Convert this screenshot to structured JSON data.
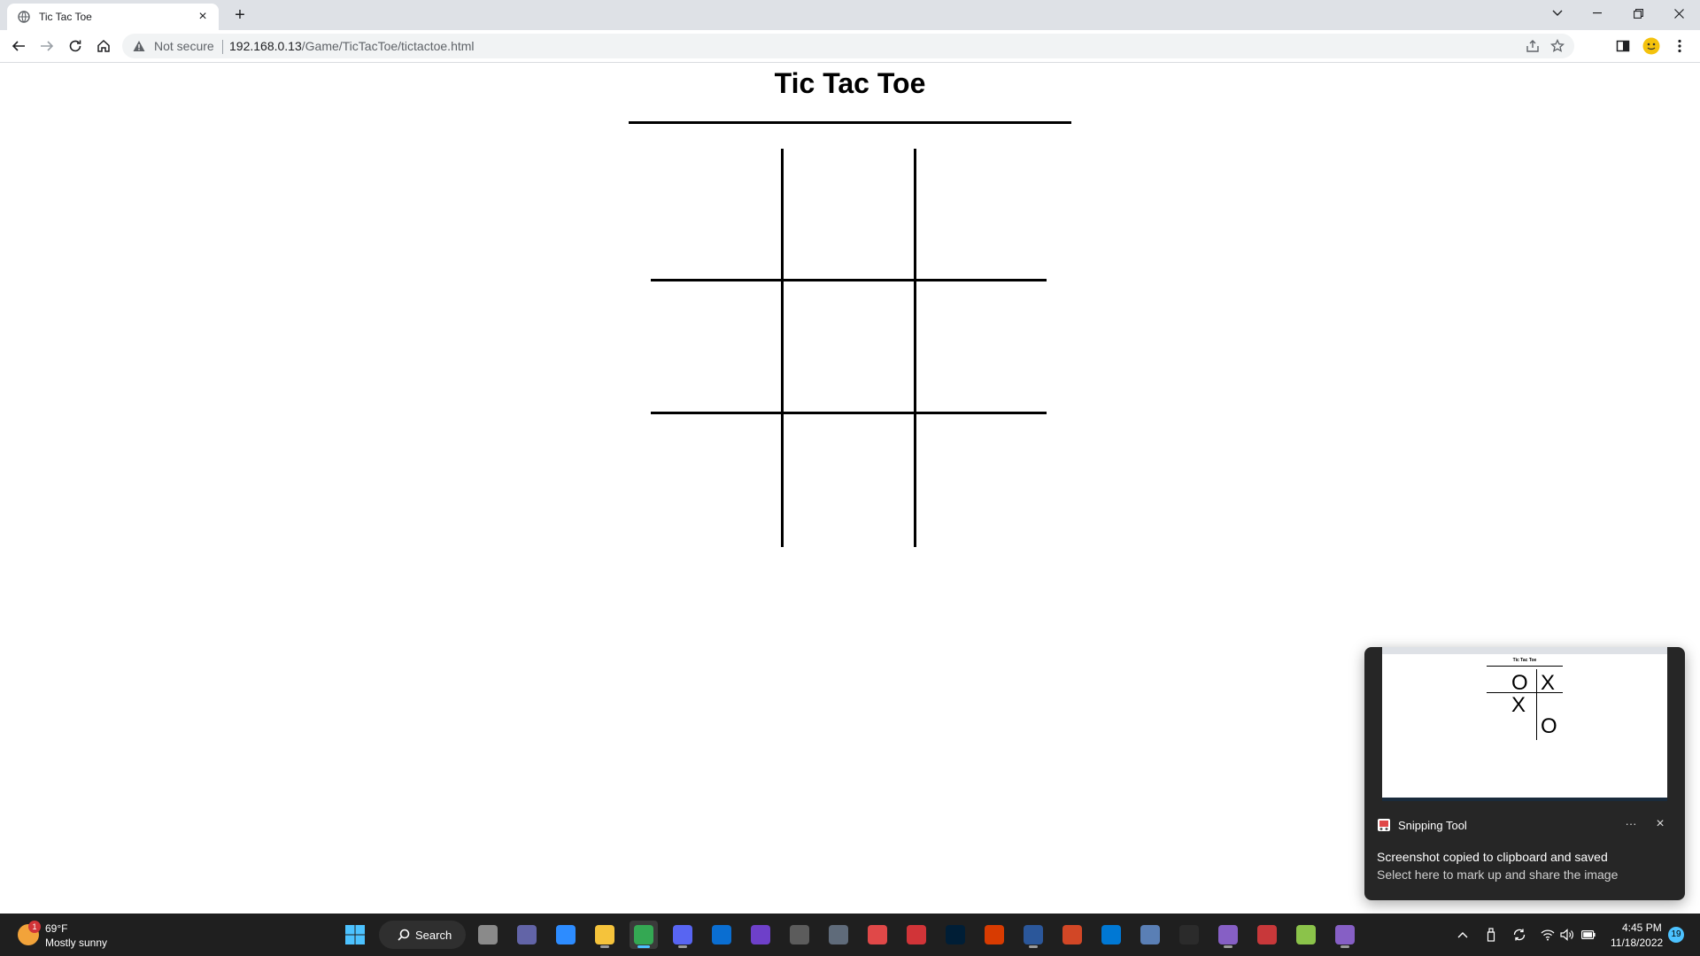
{
  "browser": {
    "tab_title": "Tic Tac Toe",
    "tab_close_glyph": "×",
    "newtab_glyph": "+",
    "security_label": "Not secure",
    "url_host": "192.168.0.13",
    "url_path": "/Game/TicTacToe/tictactoe.html"
  },
  "page": {
    "title": "Tic Tac Toe",
    "board": [
      "",
      "",
      "",
      "",
      "",
      "",
      "",
      "",
      ""
    ]
  },
  "toast": {
    "app_name": "Snipping Tool",
    "more_glyph": "···",
    "close_glyph": "×",
    "heading": "Screenshot copied to clipboard and saved",
    "body": "Select here to mark up and share the image",
    "thumbnail": {
      "title": "Tic Tac Toe",
      "marks": [
        "O",
        "X",
        "X",
        "",
        "",
        "O"
      ]
    }
  },
  "taskbar": {
    "weather_badge": "1",
    "weather_temp": "69°F",
    "weather_desc": "Mostly sunny",
    "search_label": "Search",
    "clock_time": "4:45 PM",
    "clock_date": "11/18/2022",
    "notification_count": "19",
    "apps": [
      {
        "icon": "task-view-icon",
        "color": "#8a8a8a"
      },
      {
        "icon": "teams-chat-icon",
        "color": "#6264a7"
      },
      {
        "icon": "zoom-icon",
        "color": "#2d8cff"
      },
      {
        "icon": "file-explorer-icon",
        "color": "#f5c33b"
      },
      {
        "icon": "chrome-icon",
        "color": "#34a853"
      },
      {
        "icon": "discord-icon",
        "color": "#5865f2"
      },
      {
        "icon": "mail-icon",
        "color": "#0a6ed1"
      },
      {
        "icon": "github-icon",
        "color": "#6e40c9"
      },
      {
        "icon": "visual-studio-installer-icon",
        "color": "#5c5c5c"
      },
      {
        "icon": "calculator-icon",
        "color": "#5f6b7a"
      },
      {
        "icon": "snipping-tool-icon",
        "color": "#e04848"
      },
      {
        "icon": "screen-recorder-icon",
        "color": "#d13438"
      },
      {
        "icon": "photoshop-icon",
        "color": "#001e36"
      },
      {
        "icon": "office-icon",
        "color": "#d83b01"
      },
      {
        "icon": "word-icon",
        "color": "#2b579a"
      },
      {
        "icon": "powerpoint-icon",
        "color": "#d24726"
      },
      {
        "icon": "vscode-icon",
        "color": "#0078d4"
      },
      {
        "icon": "remote-desktop-icon",
        "color": "#5a7fb5"
      },
      {
        "icon": "terminal-icon",
        "color": "#2b2b2b"
      },
      {
        "icon": "visual-studio-icon",
        "color": "#865fc5"
      },
      {
        "icon": "pdf-reader-icon",
        "color": "#c8383a"
      },
      {
        "icon": "notepad-icon",
        "color": "#8bc34a"
      },
      {
        "icon": "visual-studio-preview-icon",
        "color": "#865fc5"
      }
    ]
  }
}
